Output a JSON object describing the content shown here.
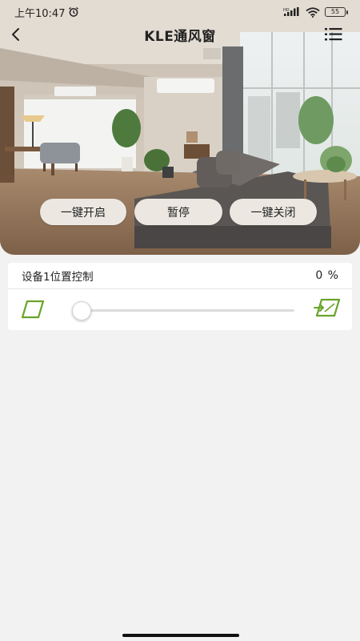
{
  "status_bar": {
    "time": "上午10:47",
    "network": "HD",
    "battery": "55"
  },
  "nav": {
    "title": "KLE通风窗"
  },
  "actions": {
    "open_all": "一键开启",
    "pause": "暂停",
    "close_all": "一键关闭"
  },
  "device": {
    "title": "设备1位置控制",
    "value": "0 %",
    "position_percent": 0
  },
  "colors": {
    "accent_green": "#6aa42a",
    "background": "#f2f2f2"
  },
  "icons": {
    "back": "chevron-left-icon",
    "menu": "list-menu-icon",
    "window_closed": "window-closed-icon",
    "window_open": "window-open-icon"
  }
}
